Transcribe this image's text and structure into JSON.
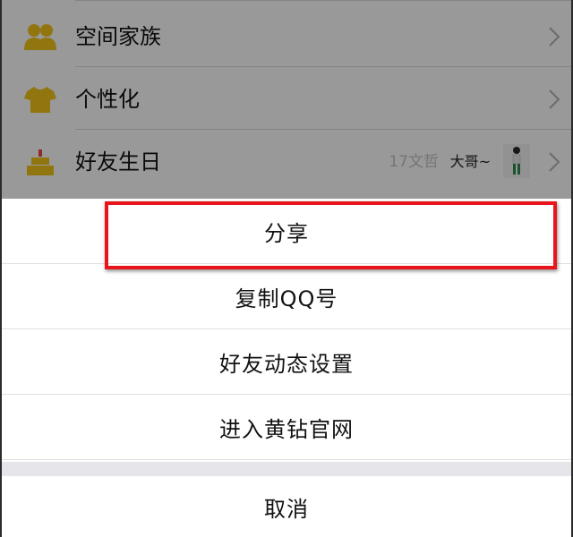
{
  "settings_list": {
    "items": [
      {
        "label": "空间家族",
        "icon": "family-icon"
      },
      {
        "label": "个性化",
        "icon": "shirt-icon"
      },
      {
        "label": "好友生日",
        "icon": "birthday-cake-icon",
        "faded_text": "17文哲",
        "friend_name": "大哥~",
        "avatar": "friend-avatar"
      }
    ]
  },
  "action_sheet": {
    "items": [
      {
        "label": "分享"
      },
      {
        "label": "复制QQ号"
      },
      {
        "label": "好友动态设置"
      },
      {
        "label": "进入黄钻官网"
      }
    ],
    "cancel_label": "取消"
  },
  "colors": {
    "icon_yellow": "#f2c41a",
    "highlight_red": "#e8161c",
    "overlay": "rgba(0,0,0,0.40)",
    "sheet_gap": "#e6e5ea"
  }
}
